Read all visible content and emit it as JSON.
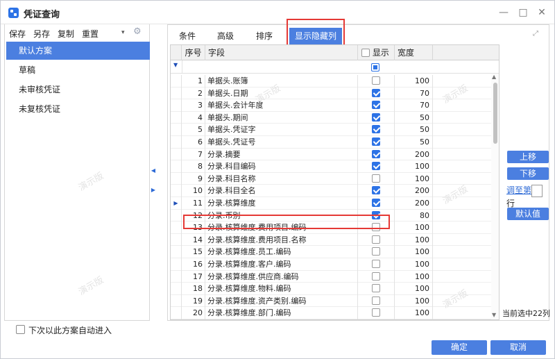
{
  "window": {
    "title": "凭证查询"
  },
  "left": {
    "toolbar": [
      "保存",
      "另存",
      "复制",
      "重置"
    ],
    "schemes": [
      "默认方案",
      "草稿",
      "未审核凭证",
      "未复核凭证"
    ],
    "auto_enter": "下次以此方案自动进入"
  },
  "tabs": [
    "条件",
    "高级",
    "排序",
    "显示隐藏列"
  ],
  "grid": {
    "headers": {
      "seq": "序号",
      "field": "字段",
      "show": "显示",
      "width": "宽度"
    },
    "rows": [
      {
        "seq": "1",
        "field": "单据头.账簿",
        "show": false,
        "width": "100"
      },
      {
        "seq": "2",
        "field": "单据头.日期",
        "show": true,
        "width": "70"
      },
      {
        "seq": "3",
        "field": "单据头.会计年度",
        "show": true,
        "width": "70"
      },
      {
        "seq": "4",
        "field": "单据头.期间",
        "show": true,
        "width": "50"
      },
      {
        "seq": "5",
        "field": "单据头.凭证字",
        "show": true,
        "width": "50"
      },
      {
        "seq": "6",
        "field": "单据头.凭证号",
        "show": true,
        "width": "50"
      },
      {
        "seq": "7",
        "field": "分录.摘要",
        "show": true,
        "width": "200"
      },
      {
        "seq": "8",
        "field": "分录.科目编码",
        "show": true,
        "width": "100"
      },
      {
        "seq": "9",
        "field": "分录.科目名称",
        "show": false,
        "width": "100"
      },
      {
        "seq": "10",
        "field": "分录.科目全名",
        "show": true,
        "width": "200"
      },
      {
        "seq": "11",
        "field": "分录.核算维度",
        "show": true,
        "width": "200"
      },
      {
        "seq": "12",
        "field": "分录.币别",
        "show": true,
        "width": "80"
      },
      {
        "seq": "13",
        "field": "分录.核算维度.费用项目.编码",
        "show": false,
        "width": "100"
      },
      {
        "seq": "14",
        "field": "分录.核算维度.费用项目.名称",
        "show": false,
        "width": "100"
      },
      {
        "seq": "15",
        "field": "分录.核算维度.员工.编码",
        "show": false,
        "width": "100"
      },
      {
        "seq": "16",
        "field": "分录.核算维度.客户.编码",
        "show": false,
        "width": "100"
      },
      {
        "seq": "17",
        "field": "分录.核算维度.供应商.编码",
        "show": false,
        "width": "100"
      },
      {
        "seq": "18",
        "field": "分录.核算维度.物料.编码",
        "show": false,
        "width": "100"
      },
      {
        "seq": "19",
        "field": "分录.核算维度.资产类别.编码",
        "show": false,
        "width": "100"
      },
      {
        "seq": "20",
        "field": "分录.核算维度.部门.编码",
        "show": false,
        "width": "100"
      }
    ]
  },
  "side": {
    "up": "上移",
    "down": "下移",
    "jump_to": "调至第",
    "row_unit": "行",
    "default": "默认值",
    "selected_count": "当前选中22列"
  },
  "watermark": "演示版",
  "footer": {
    "ok": "确定",
    "cancel": "取消"
  }
}
